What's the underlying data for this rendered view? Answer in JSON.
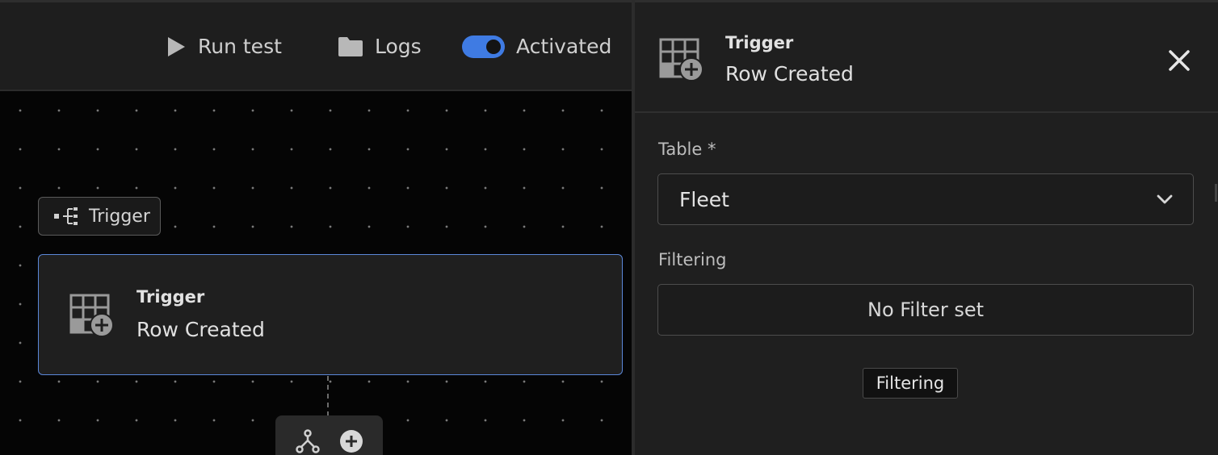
{
  "toolbar": {
    "run_test_label": "Run test",
    "logs_label": "Logs",
    "activated_label": "Activated",
    "activated_on": true
  },
  "canvas": {
    "trigger_chip_label": "Trigger",
    "card_title": "Trigger",
    "card_subtitle": "Row Created"
  },
  "panel": {
    "title": "Trigger",
    "subtitle": "Row Created",
    "table_label": "Table *",
    "table_value": "Fleet",
    "filtering_label": "Filtering",
    "filter_button_label": "No Filter set",
    "tooltip_text": "Filtering"
  },
  "colors": {
    "accent": "#3f7be3",
    "card_border": "#5b87d8",
    "background": "#050505",
    "panel": "#1f1f1f"
  },
  "icons": [
    "play-icon",
    "folder-icon",
    "toggle-switch",
    "branch-icon",
    "table-add-icon",
    "close-icon",
    "chevron-down-icon",
    "split-icon",
    "plus-circle-icon"
  ]
}
